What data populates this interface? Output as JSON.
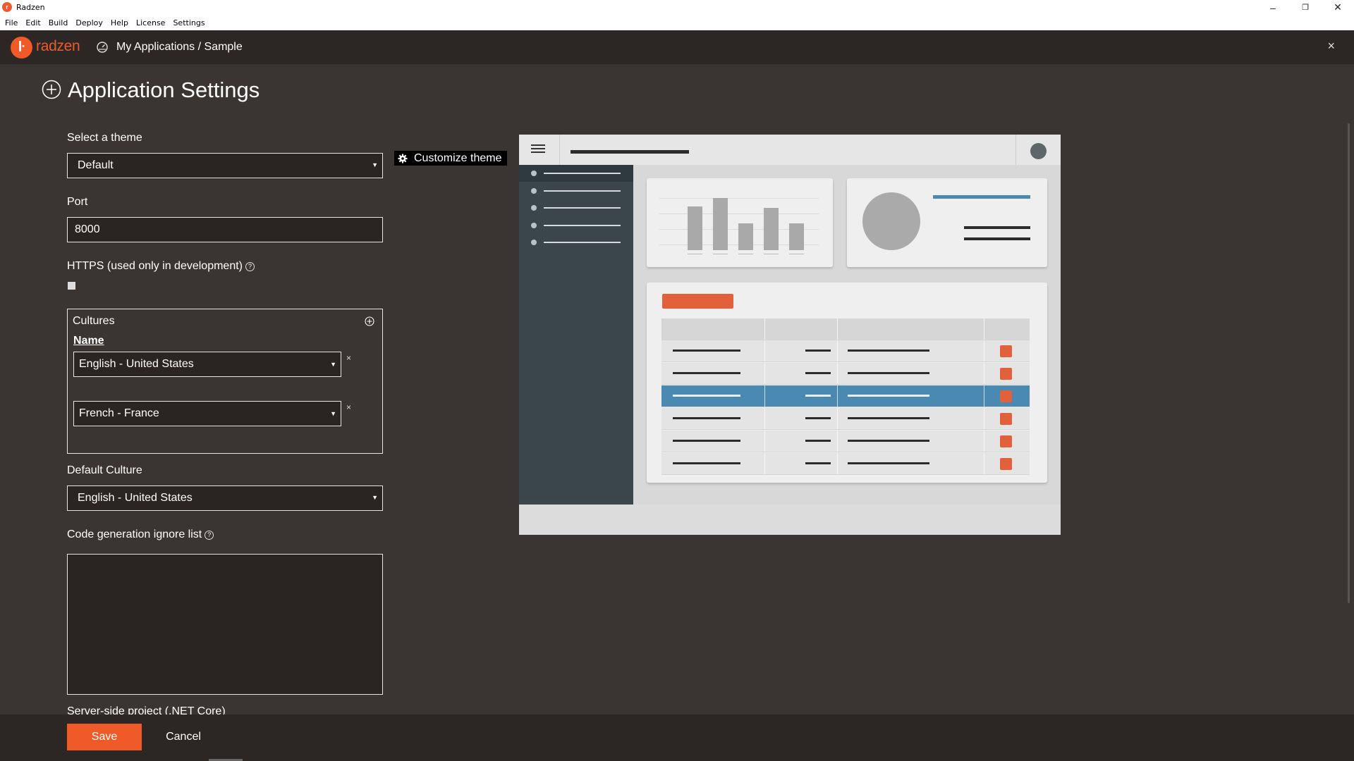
{
  "window": {
    "title": "Radzen",
    "controls": {
      "minimize": "–",
      "restore": "❐",
      "close": "✕"
    }
  },
  "menu": [
    "File",
    "Edit",
    "Build",
    "Deploy",
    "Help",
    "License",
    "Settings"
  ],
  "header": {
    "logo_text": "radzen",
    "breadcrumb": "My Applications / Sample",
    "close": "×"
  },
  "page": {
    "title": "Application Settings"
  },
  "form": {
    "theme_label": "Select a theme",
    "theme_value": "Default",
    "customize_theme": "Customize theme",
    "port_label": "Port",
    "port_value": "8000",
    "https_label": "HTTPS (used only in development)",
    "https_checked": false,
    "cultures": {
      "title": "Cultures",
      "column_name": "Name",
      "items": [
        {
          "value": "English - United States"
        },
        {
          "value": "French - France"
        }
      ],
      "remove": "×"
    },
    "default_culture_label": "Default Culture",
    "default_culture_value": "English - United States",
    "ignore_list_label": "Code generation ignore list",
    "ignore_list_value": "",
    "server_side_label": "Server-side project (.NET Core)"
  },
  "footer": {
    "save": "Save",
    "cancel": "Cancel"
  },
  "preview": {
    "description_colors": {
      "accent": "#f05a28",
      "preview_blue": "#4a89b2",
      "preview_orange": "#e2603a",
      "sidebar": "#3a464c"
    },
    "bar_chart_values": [
      62,
      74,
      38,
      60,
      38
    ],
    "table_rows": 6,
    "selected_row": 3
  },
  "icons": {
    "app": "radzen-logo-icon",
    "breadcrumb": "dashboard-gauge-icon",
    "title": "add-circle-icon",
    "gear": "gear-icon",
    "help": "help-circle-icon"
  }
}
